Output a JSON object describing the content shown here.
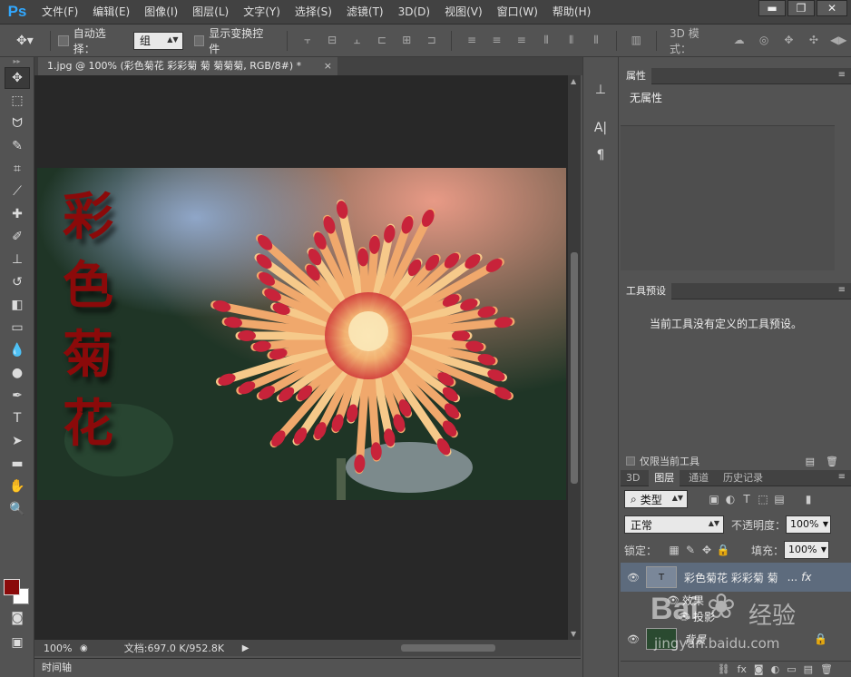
{
  "app": {
    "logo": "Ps"
  },
  "menu": [
    "文件(F)",
    "编辑(E)",
    "图像(I)",
    "图层(L)",
    "文字(Y)",
    "选择(S)",
    "滤镜(T)",
    "3D(D)",
    "视图(V)",
    "窗口(W)",
    "帮助(H)"
  ],
  "window": {
    "minimize": "▬",
    "maximize": "❐",
    "close": "✕"
  },
  "options": {
    "auto_select_label": "自动选择：",
    "auto_select_value": "组",
    "show_transform_label": "显示变换控件",
    "mode3d_label": "3D 模式："
  },
  "document": {
    "tab_title": "1.jpg @ 100% (彩色菊花 彩彩菊 菊 菊菊菊, RGB/8#) *",
    "tab_close": "×",
    "zoom": "100%",
    "doc_info": "文档:697.0 K/952.8K",
    "overlay_text": "彩色菊花"
  },
  "timeline": {
    "label": "时间轴"
  },
  "properties": {
    "tab": "属性",
    "body": "无属性"
  },
  "presets": {
    "tab": "工具预设",
    "body": "当前工具没有定义的工具预设。",
    "current_only_label": "仅限当前工具"
  },
  "layers": {
    "tabs": [
      "3D",
      "图层",
      "通道",
      "历史记录"
    ],
    "filter_kind": "类型",
    "blend_mode": "正常",
    "opacity_label": "不透明度：",
    "opacity_value": "100%",
    "lock_label": "锁定：",
    "fill_label": "填充：",
    "fill_value": "100%",
    "items": [
      {
        "name": "彩色菊花 彩彩菊 菊",
        "fx": "fx",
        "ellipsis": "..."
      },
      {
        "name": "效果"
      },
      {
        "name": "投影"
      },
      {
        "name": "背景"
      }
    ]
  },
  "watermark": {
    "brand": "Bai",
    "brand2": "经验",
    "url": "jingyan.baidu.com"
  },
  "colors": {
    "fg": "#8a0a0a",
    "bg": "#ffffff",
    "accent": "#31a8ff",
    "overlay_red": "#8b0a0a"
  }
}
